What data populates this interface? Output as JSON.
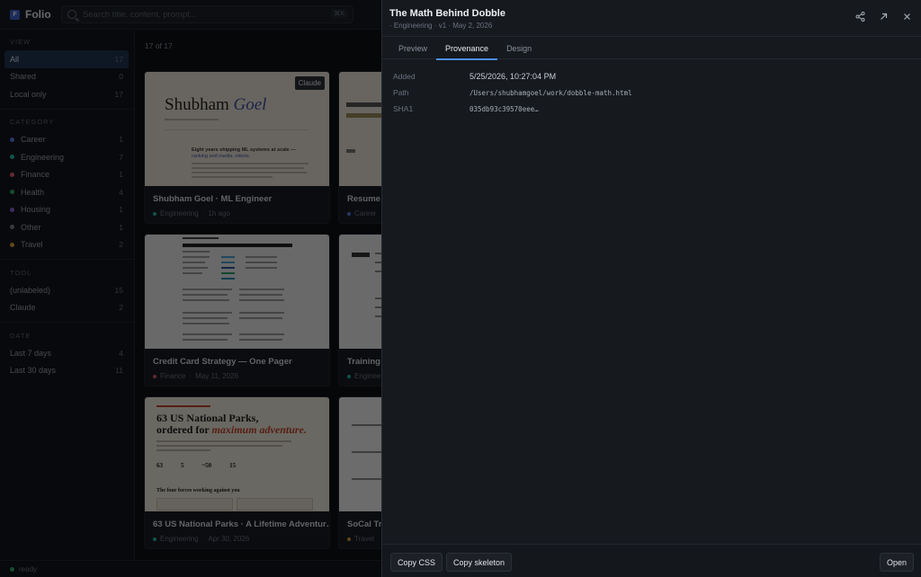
{
  "app": {
    "name": "Folio",
    "logo_letter": "F"
  },
  "search": {
    "placeholder": "Search title, content, prompt...",
    "shortcut": "⌘K"
  },
  "sidebar": {
    "view_heading": "VIEW",
    "view": [
      {
        "label": "All",
        "count": "17",
        "active": true
      },
      {
        "label": "Shared",
        "count": "0"
      },
      {
        "label": "Local only",
        "count": "17"
      }
    ],
    "category_heading": "CATEGORY",
    "categories": [
      {
        "label": "Career",
        "count": "1",
        "color": "#5b7be0"
      },
      {
        "label": "Engineering",
        "count": "7",
        "color": "#22b8a8"
      },
      {
        "label": "Finance",
        "count": "1",
        "color": "#e05a6b"
      },
      {
        "label": "Health",
        "count": "4",
        "color": "#2eaa6a"
      },
      {
        "label": "Housing",
        "count": "1",
        "color": "#8a63d2"
      },
      {
        "label": "Other",
        "count": "1",
        "color": "#7b828c"
      },
      {
        "label": "Travel",
        "count": "2",
        "color": "#d99a3a"
      }
    ],
    "tool_heading": "TOOL",
    "tools": [
      {
        "label": "(unlabeled)",
        "count": "15"
      },
      {
        "label": "Claude",
        "count": "2"
      }
    ],
    "date_heading": "DATE",
    "dates": [
      {
        "label": "Last 7 days",
        "count": "4"
      },
      {
        "label": "Last 30 days",
        "count": "11"
      }
    ]
  },
  "main": {
    "count_label": "17 of 17",
    "cards": [
      {
        "title": "Shubham Goel · ML Engineer",
        "category": "Engineering",
        "date": "1h ago",
        "badge": "Claude",
        "thumb_title": "Shubham",
        "thumb_title_italic": "Goel",
        "thumb_headline": "Eight years shipping ML systems at scale —",
        "thumb_subline": "ranking and media. robots."
      },
      {
        "title": "Resume F",
        "category": "Career",
        "date": ""
      },
      {
        "title": "Credit Card Strategy — One Pager",
        "category": "Finance",
        "date": "May 11, 2026"
      },
      {
        "title": "Training A",
        "category": "Enginee",
        "date": ""
      },
      {
        "title": "63 US National Parks · A Lifetime Adventur…",
        "category": "Engineering",
        "date": "Apr 30, 2026",
        "thumb_title_a": "63 US National Parks,",
        "thumb_title_b": "ordered for",
        "thumb_title_italic": "maximum adventure.",
        "thumb_nums": [
          "63",
          "5",
          "~50",
          "15"
        ],
        "thumb_sub": "The four forces working against you"
      },
      {
        "title": "SoCal Trip",
        "category": "Travel",
        "date": ""
      }
    ]
  },
  "status": {
    "text": "ready",
    "color": "#2ea86a"
  },
  "panel": {
    "title": "The Math Behind Dobble",
    "subtitle": "· Engineering · v1 · May 2, 2026",
    "tabs": [
      "Preview",
      "Provenance",
      "Design"
    ],
    "active_tab": "Provenance",
    "provenance": [
      {
        "key": "Added",
        "value": "5/25/2026, 10:27:04 PM"
      },
      {
        "key": "Path",
        "value": "/Users/shubhamgoel/work/dobble-math.html"
      },
      {
        "key": "SHA1",
        "value": "035db93c39570eee…"
      }
    ],
    "buttons": {
      "copy_css": "Copy CSS",
      "copy_skeleton": "Copy skeleton",
      "open": "Open"
    },
    "icons": [
      "share-icon",
      "open-external-icon",
      "close-icon"
    ]
  },
  "colors": {
    "accent": "#4d8ef7",
    "active_bg": "#1f3350"
  }
}
